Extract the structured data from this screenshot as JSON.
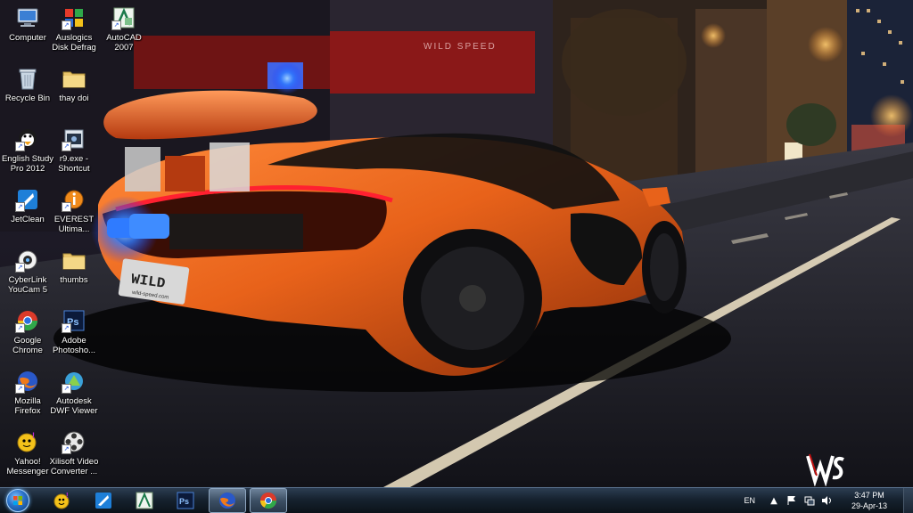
{
  "desktop": {
    "icons": [
      {
        "id": "computer",
        "label": "Computer",
        "icon": "computer-icon"
      },
      {
        "id": "auslogics",
        "label": "Auslogics\nDisk Defrag",
        "icon": "defrag-icon"
      },
      {
        "id": "autocad",
        "label": "AutoCAD\n2007",
        "icon": "autocad-icon"
      },
      {
        "id": "recycle",
        "label": "Recycle Bin",
        "icon": "recycle-bin-icon"
      },
      {
        "id": "thaydoi",
        "label": "thay doi",
        "icon": "folder-icon"
      },
      {
        "id": "englishstudy",
        "label": "English Study\nPro 2012",
        "icon": "english-study-icon"
      },
      {
        "id": "r9shortcut",
        "label": "r9.exe -\nShortcut",
        "icon": "shortcut-exe-icon"
      },
      {
        "id": "jetclean",
        "label": "JetClean",
        "icon": "jetclean-icon"
      },
      {
        "id": "everest",
        "label": "EVEREST\nUltima...",
        "icon": "everest-icon"
      },
      {
        "id": "cyberlink",
        "label": "CyberLink\nYouCam 5",
        "icon": "youcam-icon"
      },
      {
        "id": "thumbs",
        "label": "thumbs",
        "icon": "folder-icon"
      },
      {
        "id": "chrome",
        "label": "Google\nChrome",
        "icon": "chrome-icon"
      },
      {
        "id": "photoshop",
        "label": "Adobe\nPhotosho...",
        "icon": "photoshop-icon"
      },
      {
        "id": "firefox",
        "label": "Mozilla\nFirefox",
        "icon": "firefox-icon"
      },
      {
        "id": "dwfviewer",
        "label": "Autodesk\nDWF Viewer",
        "icon": "dwf-viewer-icon"
      },
      {
        "id": "yahoo",
        "label": "Yahoo!\nMessenger",
        "icon": "yahoo-messenger-icon"
      },
      {
        "id": "xilisoft",
        "label": "Xilisoft Video\nConverter ...",
        "icon": "video-converter-icon"
      }
    ]
  },
  "wallpaper": {
    "sign_text": "WILD SPEED",
    "plate_text": "WILD",
    "plate_sub": "wild-speed.com"
  },
  "taskbar": {
    "pins": [
      {
        "id": "yahoo",
        "icon": "yahoo-messenger-icon",
        "active": false
      },
      {
        "id": "jetclean",
        "icon": "jetclean-icon",
        "active": false
      },
      {
        "id": "autocad",
        "icon": "autocad-icon",
        "active": false
      },
      {
        "id": "photoshop",
        "icon": "photoshop-icon",
        "active": false
      },
      {
        "id": "firefox",
        "icon": "firefox-icon",
        "active": true
      },
      {
        "id": "chrome",
        "icon": "chrome-icon",
        "active": true
      }
    ],
    "tray": {
      "language": "EN",
      "time": "3:47 PM",
      "date": "29-Apr-13"
    }
  },
  "colors": {
    "car_orange": "#e8621a",
    "taskbar_top": "#2c3d52",
    "taskbar_bottom": "#0b1219",
    "street_light": "#ffb347",
    "exhaust_blue": "#2f7bff"
  }
}
